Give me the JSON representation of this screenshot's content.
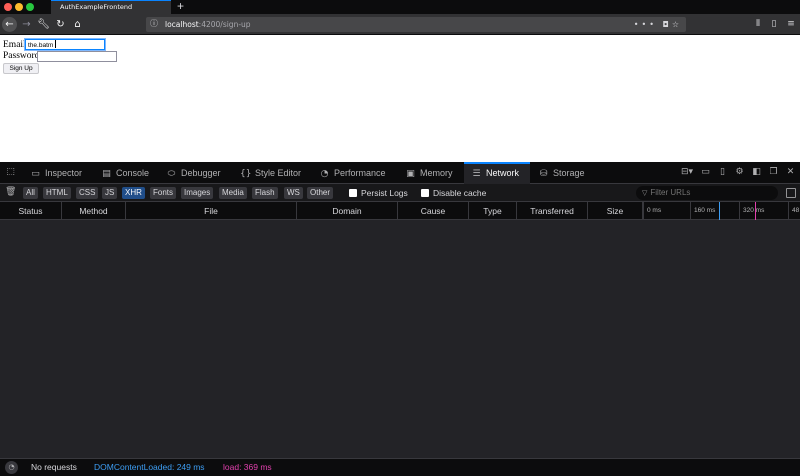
{
  "window": {
    "tab_title": "AuthExampleFrontend",
    "new_tab_symbol": "+"
  },
  "navbar": {
    "back_icon": "arrow-left-icon",
    "forward_icon": "arrow-right-icon",
    "url_host": "localhost",
    "url_path": ":4200/sign-up",
    "page_actions": "•••"
  },
  "page": {
    "email_label": "Email",
    "email_value": "the.batm",
    "password_label": "Password",
    "password_value": "",
    "signup_label": "Sign Up"
  },
  "devtools": {
    "tabs": [
      {
        "label": "Inspector",
        "icon": "inspector-icon"
      },
      {
        "label": "Console",
        "icon": "console-icon"
      },
      {
        "label": "Debugger",
        "icon": "debugger-icon"
      },
      {
        "label": "Style Editor",
        "icon": "braces-icon"
      },
      {
        "label": "Performance",
        "icon": "performance-icon"
      },
      {
        "label": "Memory",
        "icon": "memory-icon"
      },
      {
        "label": "Network",
        "icon": "network-icon"
      },
      {
        "label": "Storage",
        "icon": "storage-icon"
      }
    ],
    "active_tab": "Network",
    "filter_types": [
      "All",
      "HTML",
      "CSS",
      "JS",
      "XHR",
      "Fonts",
      "Images",
      "Media",
      "Flash",
      "WS",
      "Other"
    ],
    "selected_filter": "XHR",
    "persist_logs_label": "Persist Logs",
    "disable_cache_label": "Disable cache",
    "filter_placeholder": "Filter URLs",
    "columns": [
      "Status",
      "Method",
      "File",
      "Domain",
      "Cause",
      "Type",
      "Transferred",
      "Size"
    ],
    "waterfall_ticks": [
      "0 ms",
      "160 ms",
      "320 ms",
      "48"
    ],
    "status": {
      "requests": "No requests",
      "dom_content_loaded": "DOMContentLoaded: 249 ms",
      "load": "load: 369 ms"
    }
  },
  "colors": {
    "accent": "#0a84ff",
    "dom_loaded": "#3d9df2",
    "load": "#e140ad"
  }
}
